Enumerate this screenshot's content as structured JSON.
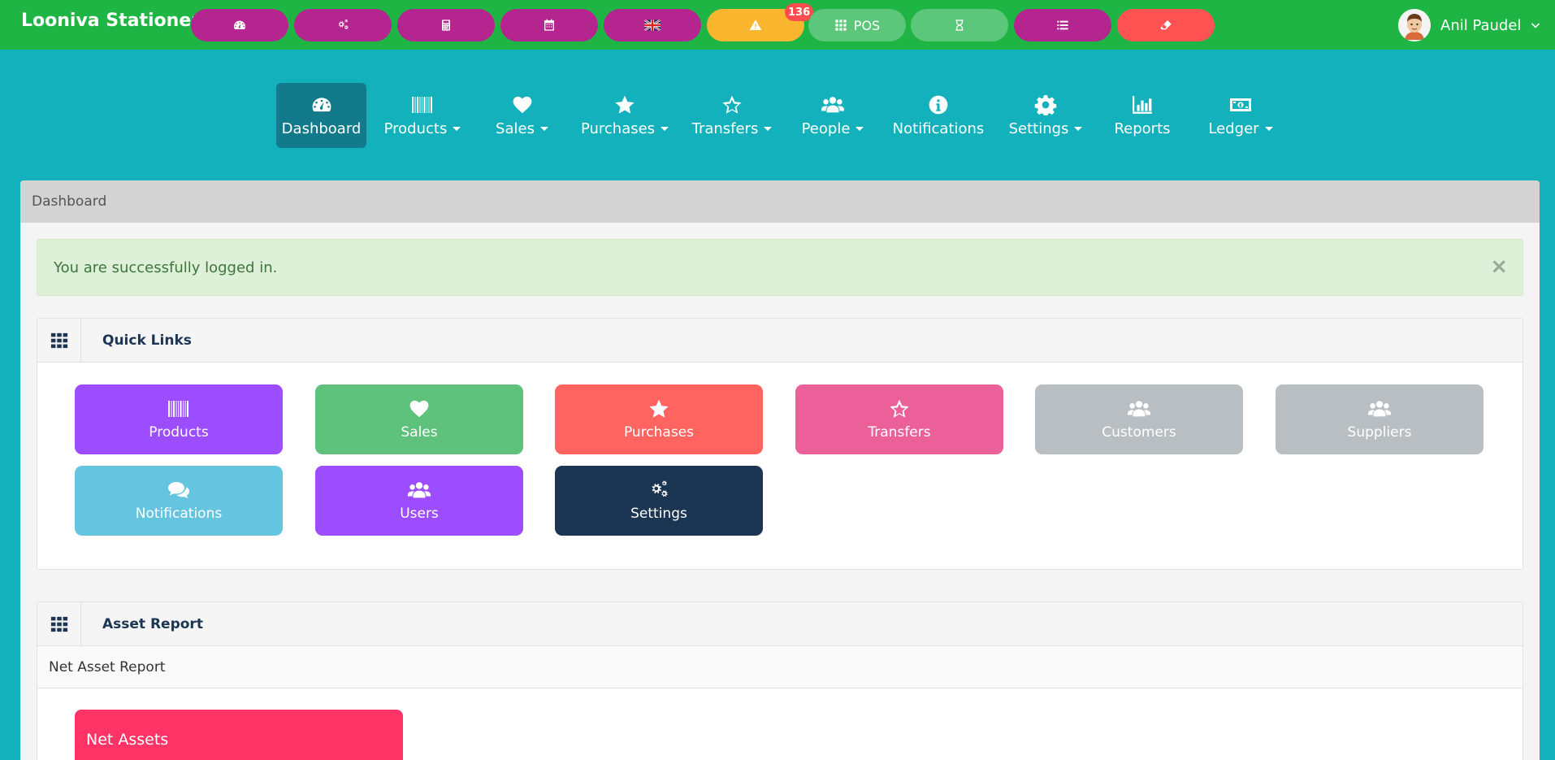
{
  "app": {
    "brand": "Looniva Stationery"
  },
  "topbar": {
    "buttons": [
      {
        "icon": "dashboard-icon",
        "label": "",
        "color": "#b5258f"
      },
      {
        "icon": "cogs-icon",
        "label": "",
        "color": "#b5258f"
      },
      {
        "icon": "calculator-icon",
        "label": "",
        "color": "#b5258f"
      },
      {
        "icon": "calendar-icon",
        "label": "",
        "color": "#b5258f"
      },
      {
        "icon": "uk-flag-icon",
        "label": "",
        "color": "#b5258f"
      },
      {
        "icon": "warning-icon",
        "label": "",
        "color": "#fbb630"
      },
      {
        "icon": "grid-icon",
        "label": "POS",
        "color": "#5cc67a"
      },
      {
        "icon": "hourglass-icon",
        "label": "",
        "color": "#5cc67a"
      },
      {
        "icon": "list-icon",
        "label": "",
        "color": "#b5258f"
      },
      {
        "icon": "eraser-icon",
        "label": "",
        "color": "#ff5252"
      }
    ],
    "alert_count": "136",
    "user_name": "Anil Paudel"
  },
  "nav": {
    "items": [
      {
        "label": "Dashboard",
        "icon": "dashboard-icon",
        "dropdown": false,
        "active": true
      },
      {
        "label": "Products",
        "icon": "barcode-icon",
        "dropdown": true,
        "active": false
      },
      {
        "label": "Sales",
        "icon": "heart-icon",
        "dropdown": true,
        "active": false
      },
      {
        "label": "Purchases",
        "icon": "star-icon",
        "dropdown": true,
        "active": false
      },
      {
        "label": "Transfers",
        "icon": "star-outline-icon",
        "dropdown": true,
        "active": false
      },
      {
        "label": "People",
        "icon": "users-icon",
        "dropdown": true,
        "active": false
      },
      {
        "label": "Notifications",
        "icon": "info-icon",
        "dropdown": false,
        "active": false
      },
      {
        "label": "Settings",
        "icon": "cog-icon",
        "dropdown": true,
        "active": false
      },
      {
        "label": "Reports",
        "icon": "bar-chart-icon",
        "dropdown": false,
        "active": false
      },
      {
        "label": "Ledger",
        "icon": "money-icon",
        "dropdown": true,
        "active": false
      }
    ]
  },
  "breadcrumb": "Dashboard",
  "alert": {
    "message": "You are successfully logged in.",
    "close": "×"
  },
  "quick_links": {
    "title": "Quick Links",
    "items": [
      {
        "label": "Products",
        "icon": "barcode-icon",
        "color": "#9b4dff"
      },
      {
        "label": "Sales",
        "icon": "heart-icon",
        "color": "#5ec27d"
      },
      {
        "label": "Purchases",
        "icon": "star-icon",
        "color": "#ff6461"
      },
      {
        "label": "Transfers",
        "icon": "star-outline-icon",
        "color": "#eb6098"
      },
      {
        "label": "Customers",
        "icon": "users-icon",
        "color": "#b9bec2"
      },
      {
        "label": "Suppliers",
        "icon": "users-icon",
        "color": "#b9bec2"
      },
      {
        "label": "Notifications",
        "icon": "comments-icon",
        "color": "#65c4e0"
      },
      {
        "label": "Users",
        "icon": "users-icon",
        "color": "#9b4dff"
      },
      {
        "label": "Settings",
        "icon": "cogs-icon",
        "color": "#1b3553"
      }
    ]
  },
  "asset_report": {
    "title": "Asset Report",
    "subtitle": "Net Asset Report",
    "card_label": "Net Assets",
    "card_color": "#ff3366"
  }
}
